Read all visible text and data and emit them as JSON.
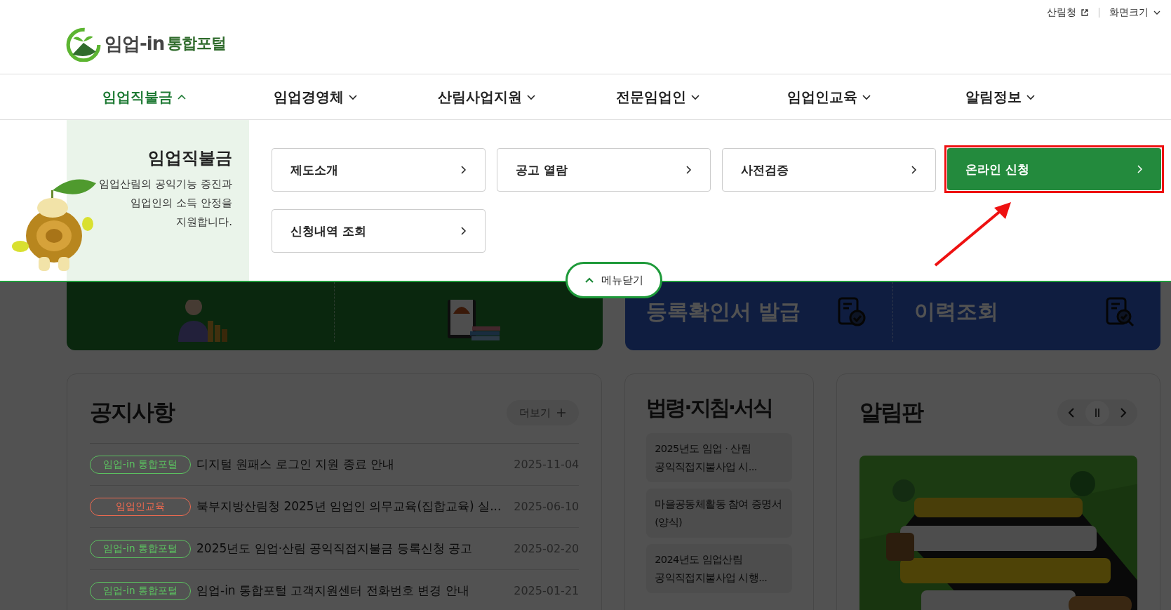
{
  "top_links": [
    {
      "label": "산림청",
      "kind": "external"
    },
    {
      "label": "화면크기",
      "kind": "dropdown"
    }
  ],
  "logo": {
    "text": "임업-in",
    "accent": "통합포털"
  },
  "nav": [
    {
      "label": "임업직불금",
      "selected": true
    },
    {
      "label": "임업경영체",
      "selected": false
    },
    {
      "label": "산림사업지원",
      "selected": false
    },
    {
      "label": "전문임업인",
      "selected": false
    },
    {
      "label": "임업인교육",
      "selected": false
    },
    {
      "label": "알림정보",
      "selected": false
    }
  ],
  "dropdown": {
    "title": "임업직불금",
    "description": "임업산림의 공익기능 증진과\n임업인의 소득 안정을\n지원합니다.",
    "items": [
      {
        "label": "제도소개",
        "highlighted": false
      },
      {
        "label": "공고 열람",
        "highlighted": false
      },
      {
        "label": "사전검증",
        "highlighted": false
      },
      {
        "label": "온라인 신청",
        "highlighted": true
      },
      {
        "label": "신청내역 조회",
        "highlighted": false
      }
    ],
    "close_label": "메뉴닫기"
  },
  "blue_banner": [
    {
      "label": "등록확인서 발급",
      "kind": "check"
    },
    {
      "label": "이력조회",
      "kind": "search"
    }
  ],
  "notices": {
    "title": "공지사항",
    "more": "더보기",
    "rows": [
      {
        "tag": "임업-in 통합포털",
        "color": "#5cc060",
        "title": "디지털 원패스 로그인 지원 종료 안내",
        "date": "2025-11-04"
      },
      {
        "tag": "임업인교육",
        "color": "#ee6a50",
        "title": "북부지방산림청 2025년 임업인 의무교육(집합교육) 실...",
        "date": "2025-06-10"
      },
      {
        "tag": "임업-in 통합포털",
        "color": "#5cc060",
        "title": "2025년도 임업·산림 공익직접지불금 등록신청 공고",
        "date": "2025-02-20"
      },
      {
        "tag": "임업-in 통합포털",
        "color": "#5cc060",
        "title": "임업-in 통합포털 고객지원센터 전화번호 변경 안내",
        "date": "2025-01-21"
      }
    ]
  },
  "laws": {
    "title": "법령·지침·서식",
    "items": [
      "2025년도 임업 · 산림 공익직접지불사업 시...",
      "마을공동체활동 참여 증명서(양식)",
      "2024년도 임업산림 공익직접지불사업 시행..."
    ]
  },
  "board": {
    "title": "알림판"
  }
}
